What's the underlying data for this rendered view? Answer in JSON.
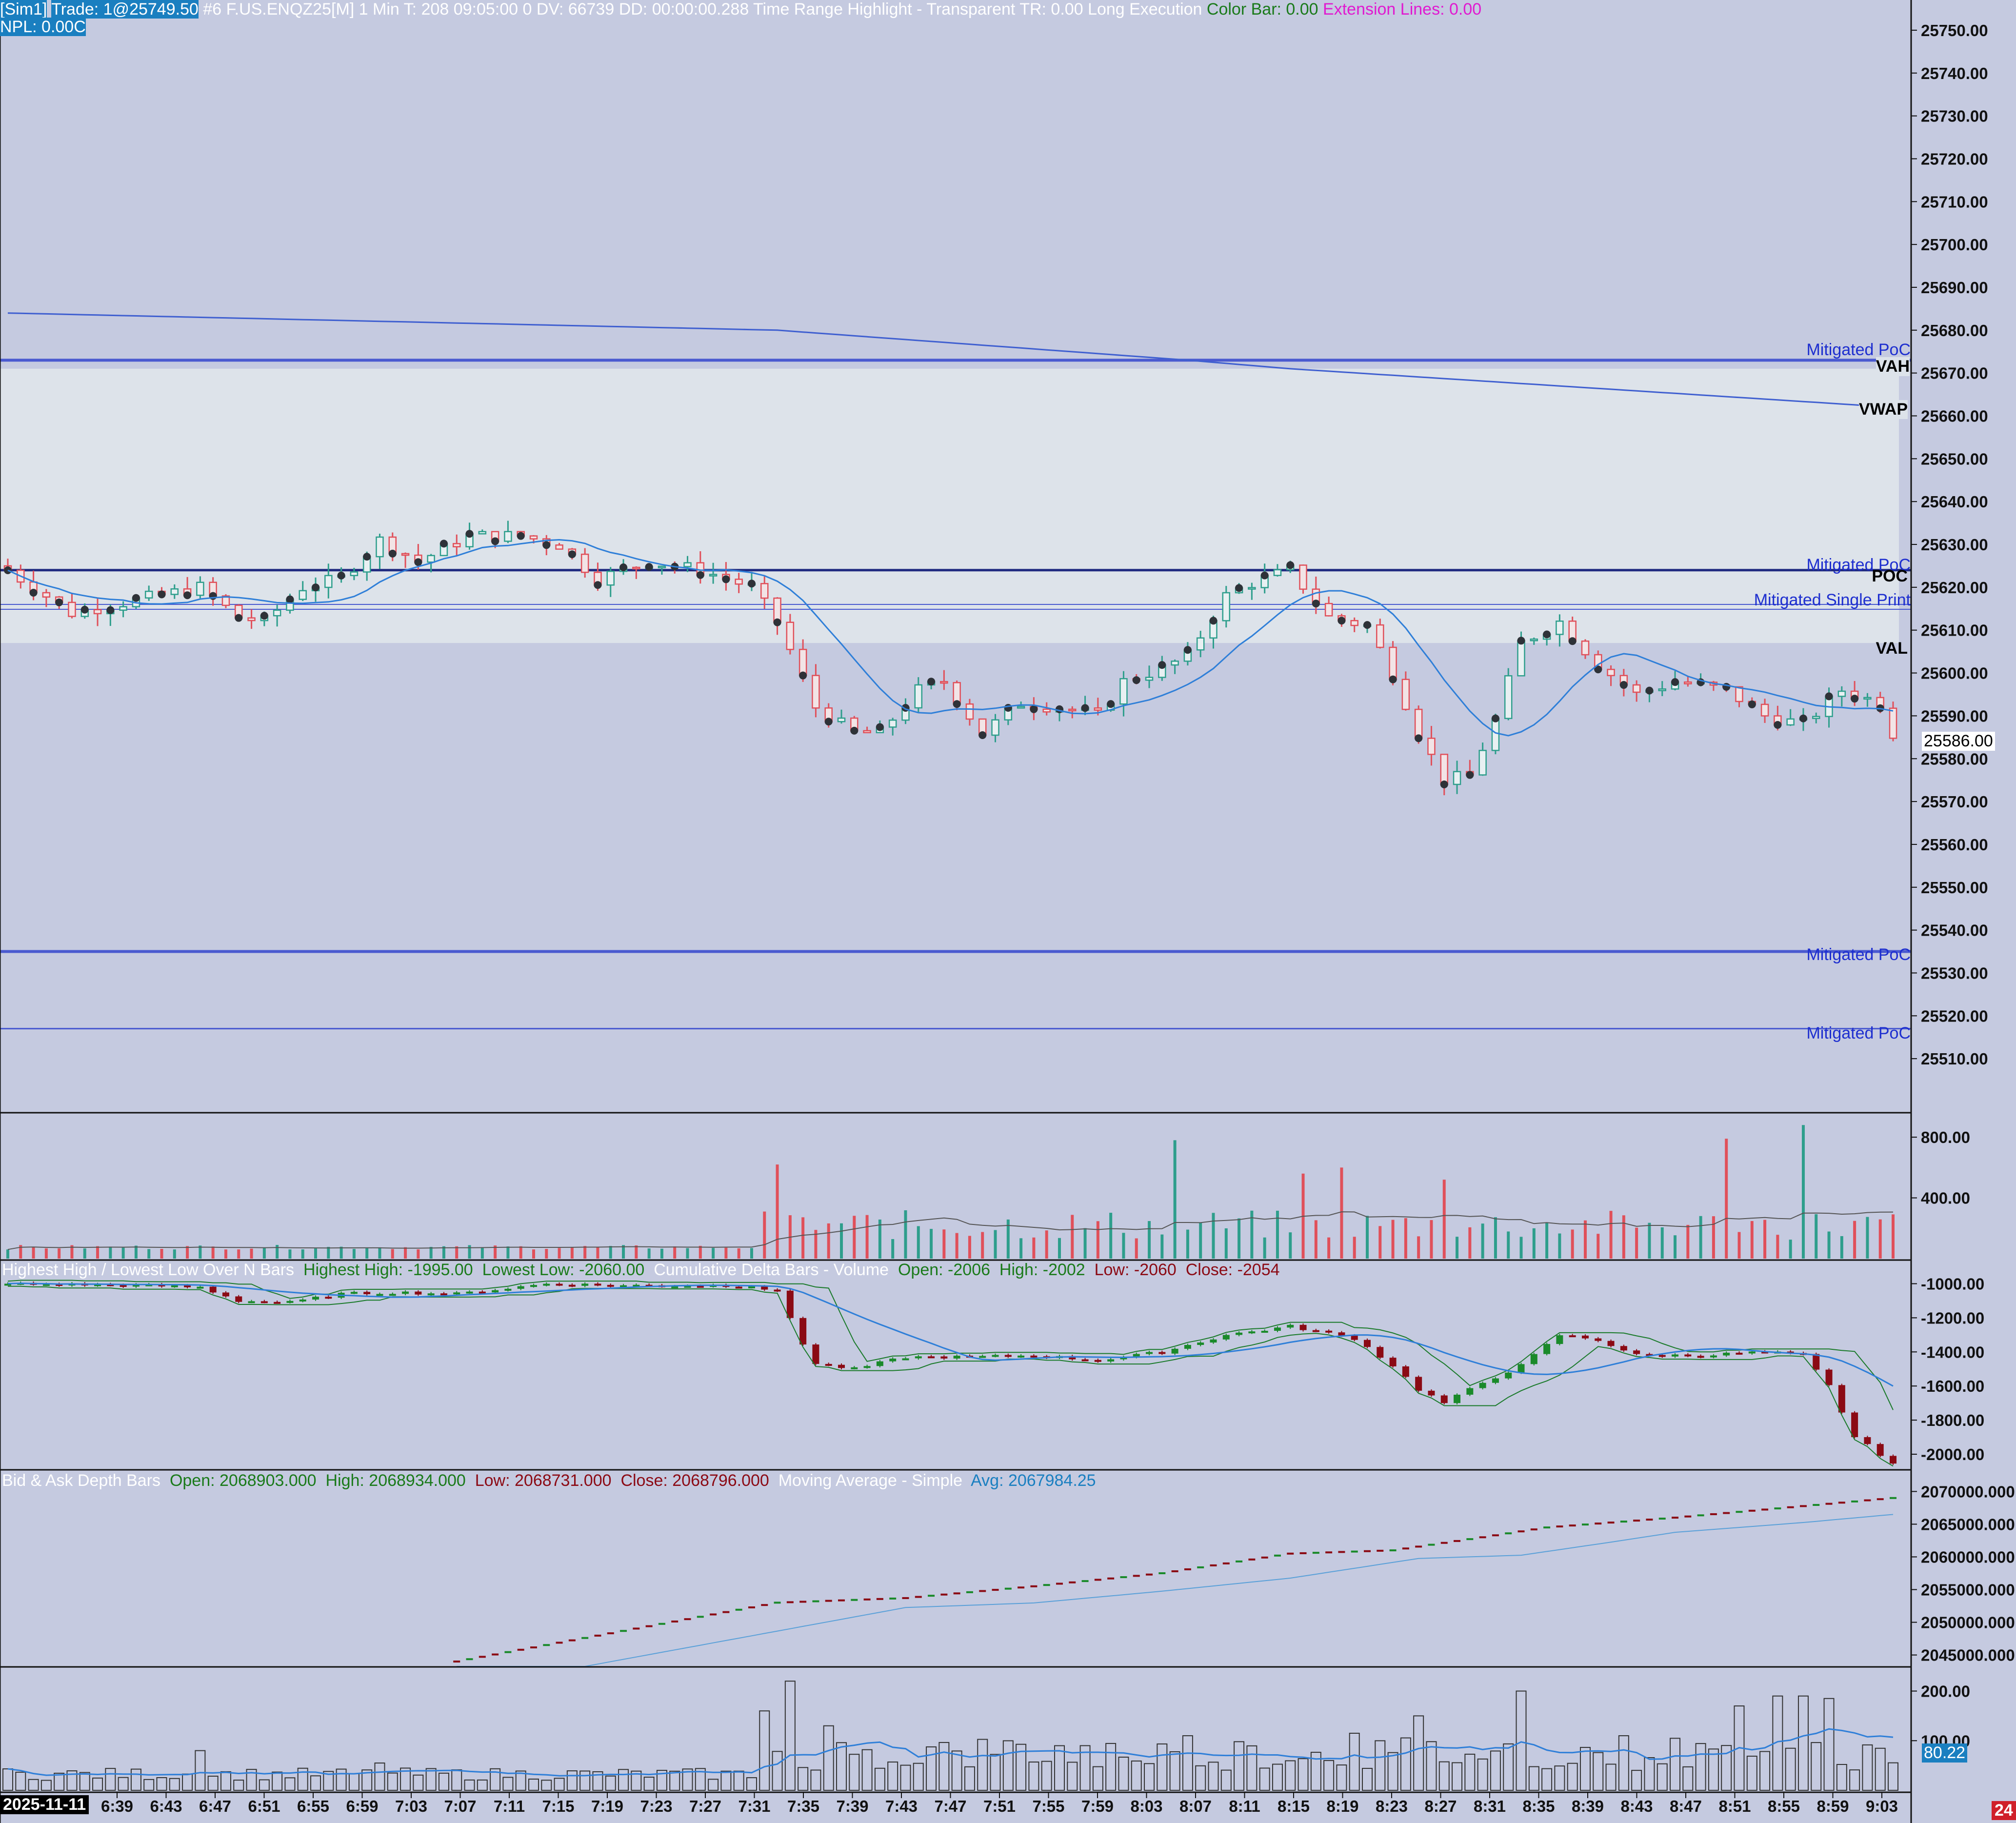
{
  "header": {
    "sim": "[Sim1]",
    "trade": "Trade: 1@25749.50",
    "info": "#6 F.US.ENQZ25[M]  1 Min  T: 208 09:05:00 0 DV: 66739 DD: 00:00:00.288 Time Range Highlight - Transparent  TR: 0.00  Long Execution",
    "color_bar": "Color Bar: 0.00",
    "extension_lines": "Extension Lines: 0.00",
    "npl": "NPL: 0.00C"
  },
  "colors": {
    "background": "#c5cae0",
    "value_area": "#dde3ea",
    "up": "#2e9e8c",
    "down": "#e0505a",
    "delta_up": "#1a8a2a",
    "delta_down": "#8b0a14",
    "ma_line": "#2f7fd8",
    "vwap_line": "#3f5fd0",
    "poc_line": "#1f2a80",
    "level_line": "#4a5ad0",
    "label_blue": "#1e2fcf"
  },
  "price_panel": {
    "levels": [
      {
        "label": "Mitigated PoC",
        "price": 25673
      },
      {
        "label": "VAH",
        "price": 25671
      },
      {
        "label": "VWAP",
        "price": 25661
      },
      {
        "label": "Mitigated PoC",
        "price": 25624
      },
      {
        "label": "POC",
        "price": 25624
      },
      {
        "label": "Mitigated Single Print",
        "price": 25616
      },
      {
        "label": "VAL",
        "price": 25607
      },
      {
        "label": "Mitigated PoC",
        "price": 25535
      },
      {
        "label": "Mitigated PoC",
        "price": 25517
      }
    ],
    "last_price": "25586.00",
    "axis_ticks": [
      "25750.00",
      "25740.00",
      "25730.00",
      "25720.00",
      "25710.00",
      "25700.00",
      "25690.00",
      "25680.00",
      "25670.00",
      "25660.00",
      "25650.00",
      "25640.00",
      "25630.00",
      "25620.00",
      "25610.00",
      "25600.00",
      "25590.00",
      "25580.00",
      "25570.00",
      "25560.00",
      "25550.00",
      "25540.00",
      "25530.00",
      "25520.00",
      "25510.00"
    ]
  },
  "volume_panel": {
    "axis_ticks": [
      "800.00",
      "400.00"
    ]
  },
  "delta_panel": {
    "title1": "Highest High / Lowest Low Over N Bars",
    "hh": "Highest High: -1995.00",
    "ll": "Lowest Low: -2060.00",
    "title2": "Cumulative Delta Bars - Volume",
    "open": "Open: -2006",
    "high": "High: -2002",
    "low": "Low: -2060",
    "close": "Close: -2054",
    "axis_ticks": [
      "-1000.00",
      "-1200.00",
      "-1400.00",
      "-1600.00",
      "-1800.00",
      "-2000.00"
    ]
  },
  "depth_panel": {
    "title": "Bid & Ask Depth Bars",
    "open": "Open: 2068903.000",
    "high": "High: 2068934.000",
    "low": "Low: 2068731.000",
    "close": "Close: 2068796.000",
    "ma_title": "Moving Average - Simple",
    "avg": "Avg: 2067984.25",
    "axis_ticks": [
      "2070000.000",
      "2065000.000",
      "2060000.000",
      "2055000.000",
      "2050000.000",
      "2045000.000"
    ]
  },
  "bottom_panel": {
    "axis_ticks": [
      "200.00",
      "100.00"
    ],
    "value_badge": "80.22"
  },
  "time_axis": {
    "date": "2025-11-11",
    "labels": [
      "6:39",
      "6:43",
      "6:47",
      "6:51",
      "6:55",
      "6:59",
      "7:03",
      "7:07",
      "7:11",
      "7:15",
      "7:19",
      "7:23",
      "7:27",
      "7:31",
      "7:35",
      "7:39",
      "7:43",
      "7:47",
      "7:51",
      "7:55",
      "7:59",
      "8:03",
      "8:07",
      "8:11",
      "8:15",
      "8:19",
      "8:23",
      "8:27",
      "8:31",
      "8:35",
      "8:39",
      "8:43",
      "8:47",
      "8:51",
      "8:55",
      "8:59",
      "9:03"
    ]
  },
  "corner_badge": "24",
  "chart_data": [
    {
      "type": "candlestick",
      "bars": 148,
      "ylim": [
        25500,
        25755
      ],
      "close_anchors": [
        [
          0,
          25624
        ],
        [
          5,
          25614
        ],
        [
          10,
          25617
        ],
        [
          15,
          25620
        ],
        [
          18,
          25613
        ],
        [
          20,
          25612
        ],
        [
          23,
          25620
        ],
        [
          26,
          25622
        ],
        [
          29,
          25631
        ],
        [
          32,
          25626
        ],
        [
          36,
          25632
        ],
        [
          40,
          25632
        ],
        [
          43,
          25630
        ],
        [
          46,
          25622
        ],
        [
          50,
          25626
        ],
        [
          54,
          25624
        ],
        [
          58,
          25620
        ],
        [
          60,
          25612
        ],
        [
          63,
          25592
        ],
        [
          66,
          25586
        ],
        [
          68,
          25586
        ],
        [
          71,
          25596
        ],
        [
          73,
          25598
        ],
        [
          76,
          25586
        ],
        [
          79,
          25593
        ],
        [
          82,
          25592
        ],
        [
          85,
          25590
        ],
        [
          87,
          25598
        ],
        [
          90,
          25601
        ],
        [
          92,
          25604
        ],
        [
          95,
          25618
        ],
        [
          97,
          25621
        ],
        [
          100,
          25624
        ],
        [
          103,
          25613
        ],
        [
          106,
          25611
        ],
        [
          108,
          25600
        ],
        [
          110,
          25586
        ],
        [
          112,
          25575
        ],
        [
          114,
          25576
        ],
        [
          116,
          25589
        ],
        [
          118,
          25607
        ],
        [
          121,
          25612
        ],
        [
          124,
          25602
        ],
        [
          127,
          25595
        ],
        [
          130,
          25598
        ],
        [
          134,
          25596
        ],
        [
          137,
          25590
        ],
        [
          140,
          25588
        ],
        [
          143,
          25596
        ],
        [
          146,
          25593
        ],
        [
          147,
          25586
        ]
      ],
      "vwap": [
        [
          0,
          25684
        ],
        [
          60,
          25680
        ],
        [
          92,
          25673
        ],
        [
          100,
          25671
        ],
        [
          147,
          25662
        ]
      ]
    },
    {
      "type": "bar",
      "name": "volume",
      "ylim": [
        0,
        900
      ],
      "spikes": [
        [
          60,
          620
        ],
        [
          91,
          780
        ],
        [
          101,
          560
        ],
        [
          104,
          600
        ],
        [
          112,
          520
        ],
        [
          134,
          790
        ],
        [
          140,
          880
        ]
      ],
      "base": 60
    },
    {
      "type": "candlestick",
      "name": "cumulative delta",
      "ylim": [
        -2060,
        -950
      ],
      "anchors": [
        [
          0,
          -1000
        ],
        [
          10,
          -1010
        ],
        [
          15,
          -1020
        ],
        [
          18,
          -1100
        ],
        [
          22,
          -1110
        ],
        [
          26,
          -1060
        ],
        [
          30,
          -1050
        ],
        [
          35,
          -1060
        ],
        [
          42,
          -1000
        ],
        [
          48,
          -1010
        ],
        [
          58,
          -1010
        ],
        [
          60,
          -1050
        ],
        [
          62,
          -1350
        ],
        [
          63,
          -1470
        ],
        [
          66,
          -1500
        ],
        [
          70,
          -1430
        ],
        [
          75,
          -1430
        ],
        [
          80,
          -1420
        ],
        [
          85,
          -1450
        ],
        [
          90,
          -1400
        ],
        [
          95,
          -1300
        ],
        [
          100,
          -1250
        ],
        [
          105,
          -1320
        ],
        [
          108,
          -1480
        ],
        [
          110,
          -1620
        ],
        [
          112,
          -1700
        ],
        [
          115,
          -1580
        ],
        [
          118,
          -1480
        ],
        [
          121,
          -1300
        ],
        [
          124,
          -1330
        ],
        [
          127,
          -1420
        ],
        [
          132,
          -1420
        ],
        [
          137,
          -1400
        ],
        [
          140,
          -1420
        ],
        [
          142,
          -1600
        ],
        [
          144,
          -1900
        ],
        [
          146,
          -2000
        ],
        [
          147,
          -2054
        ]
      ]
    },
    {
      "type": "line",
      "name": "Bid & Ask Depth Bars",
      "ylim": [
        2044000,
        2071000
      ],
      "anchors": [
        [
          35,
          2044000
        ],
        [
          60,
          2053000
        ],
        [
          70,
          2053700
        ],
        [
          80,
          2055500
        ],
        [
          90,
          2057500
        ],
        [
          100,
          2060500
        ],
        [
          108,
          2061000
        ],
        [
          115,
          2063000
        ],
        [
          120,
          2064500
        ],
        [
          130,
          2066000
        ],
        [
          147,
          2069000
        ]
      ]
    },
    {
      "type": "bar",
      "name": "lower volume",
      "ylim": [
        0,
        230
      ],
      "spikes": [
        [
          15,
          80
        ],
        [
          29,
          55
        ],
        [
          59,
          160
        ],
        [
          61,
          220
        ],
        [
          64,
          130
        ],
        [
          84,
          90
        ],
        [
          92,
          110
        ],
        [
          105,
          115
        ],
        [
          110,
          150
        ],
        [
          118,
          200
        ],
        [
          126,
          110
        ],
        [
          135,
          170
        ],
        [
          138,
          190
        ],
        [
          140,
          190
        ],
        [
          142,
          185
        ]
      ],
      "base": 20
    }
  ]
}
